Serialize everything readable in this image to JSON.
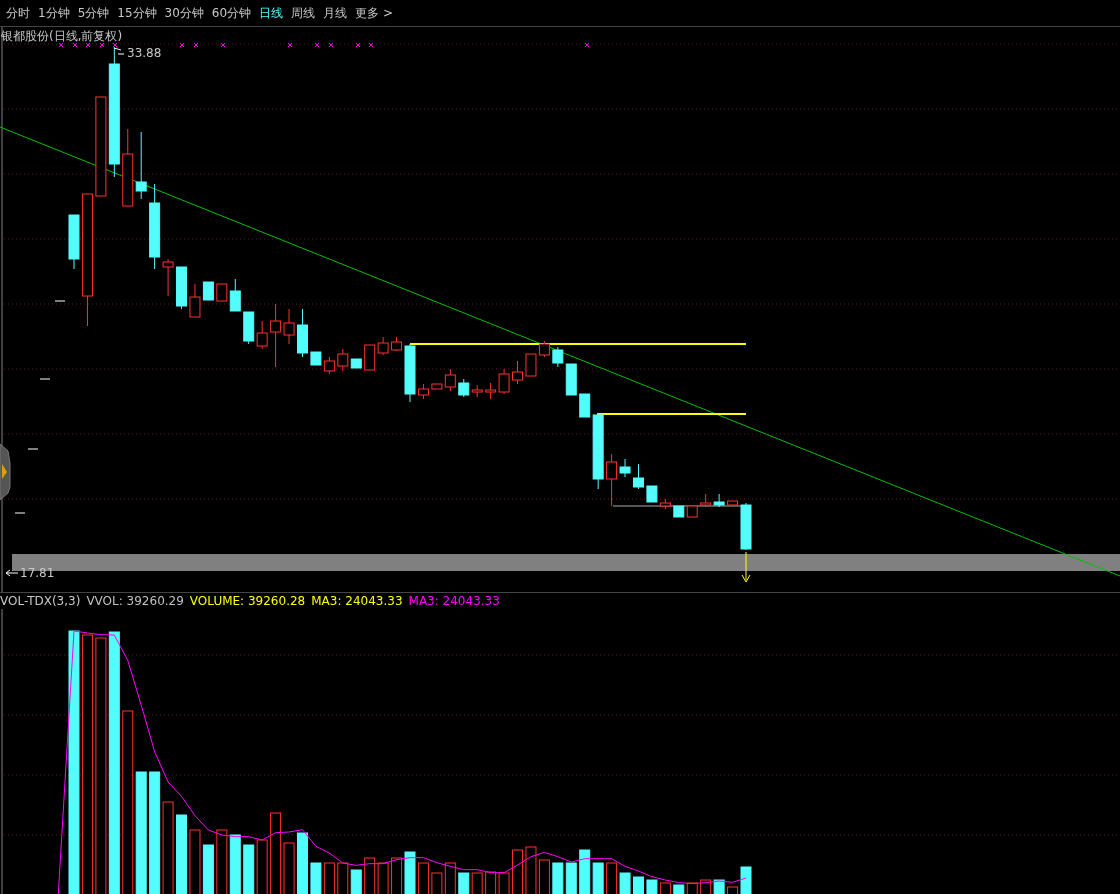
{
  "tabs": [
    {
      "label": "分时",
      "selected": false
    },
    {
      "label": "1分钟",
      "selected": false
    },
    {
      "label": "5分钟",
      "selected": false
    },
    {
      "label": "15分钟",
      "selected": false
    },
    {
      "label": "30分钟",
      "selected": false
    },
    {
      "label": "60分钟",
      "selected": false
    },
    {
      "label": "日线",
      "selected": true
    },
    {
      "label": "周线",
      "selected": false
    },
    {
      "label": "月线",
      "selected": false
    },
    {
      "label": "更多 >",
      "selected": false
    }
  ],
  "price_chart": {
    "title": "银都股份(日线,前复权)",
    "high_label": "33.88",
    "low_label": "17.81"
  },
  "volume_panel": {
    "indicator": "VOL-TDX(3,3)",
    "readouts": [
      {
        "label": "VVOL: 39260.29",
        "color": "#c0c0c0"
      },
      {
        "label": "VOLUME: 39260.28",
        "color": "#ffff00"
      },
      {
        "label": "MA3: 24043.33",
        "color": "#ffff00"
      },
      {
        "label": "MA3: 24043.33",
        "color": "#ff00ff"
      }
    ]
  }
}
